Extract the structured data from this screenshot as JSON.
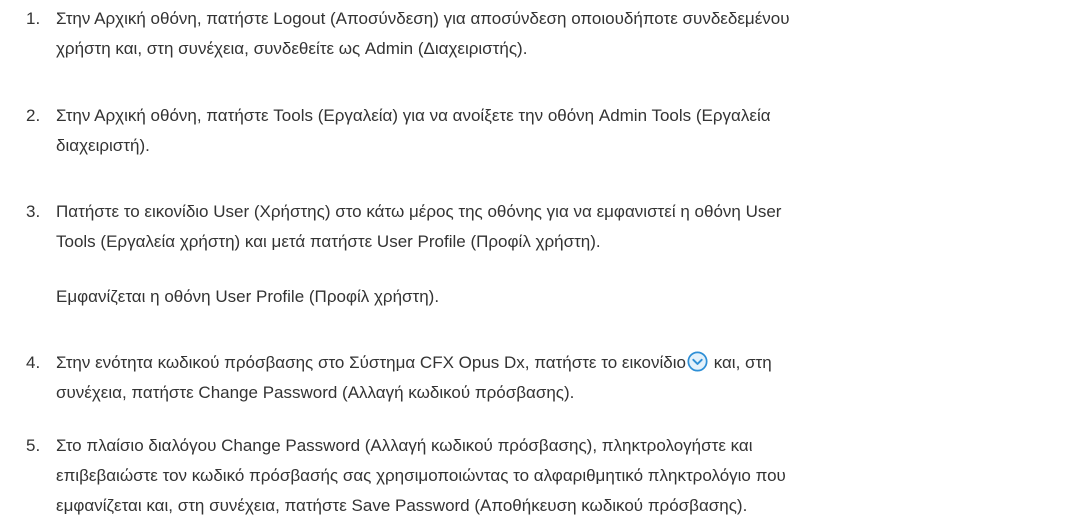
{
  "steps": [
    {
      "number": "1.",
      "lines": [
        "Στην Αρχική οθόνη, πατήστε Logout (Αποσύνδεση) για αποσύνδεση οποιουδήποτε συνδεδεμένου",
        "χρήστη και, στη συνέχεια, συνδεθείτε ως Admin (Διαχειριστής)."
      ]
    },
    {
      "number": "2.",
      "lines": [
        "Στην Αρχική οθόνη, πατήστε Tools (Εργαλεία) για να ανοίξετε την οθόνη Admin Tools (Εργαλεία",
        "διαχειριστή)."
      ]
    },
    {
      "number": "3.",
      "lines": [
        "Πατήστε το εικονίδιο User (Χρήστης) στο κάτω μέρος της οθόνης για να εμφανιστεί η οθόνη User",
        "Tools (Εργαλεία χρήστη) και μετά πατήστε User Profile (Προφίλ χρήστη)."
      ],
      "note": "Εμφανίζεται η οθόνη User Profile (Προφίλ χρήστη)."
    },
    {
      "number": "4.",
      "line1_before_icon": "Στην ενότητα κωδικού πρόσβασης στο Σύστημα CFX Opus Dx, πατήστε το εικονίδιο",
      "line1_after_icon": "και, στη",
      "icon": "chevron-down-circle-icon",
      "line2": "συνέχεια, πατήστε Change Password (Αλλαγή κωδικού πρόσβασης)."
    },
    {
      "number": "5.",
      "lines": [
        "Στο πλαίσιο διαλόγου Change Password (Αλλαγή κωδικού πρόσβασης), πληκτρολογήστε και",
        "επιβεβαιώστε τον κωδικό πρόσβασής σας χρησιμοποιώντας το αλφαριθμητικό πληκτρολόγιο που",
        "εμφανίζεται και, στη συνέχεια, πατήστε Save Password (Αποθήκευση κωδικού πρόσβασης)."
      ]
    }
  ],
  "colors": {
    "text": "#333333",
    "icon_stroke": "#2e8fd6",
    "icon_fill": "#e3f1fb"
  }
}
